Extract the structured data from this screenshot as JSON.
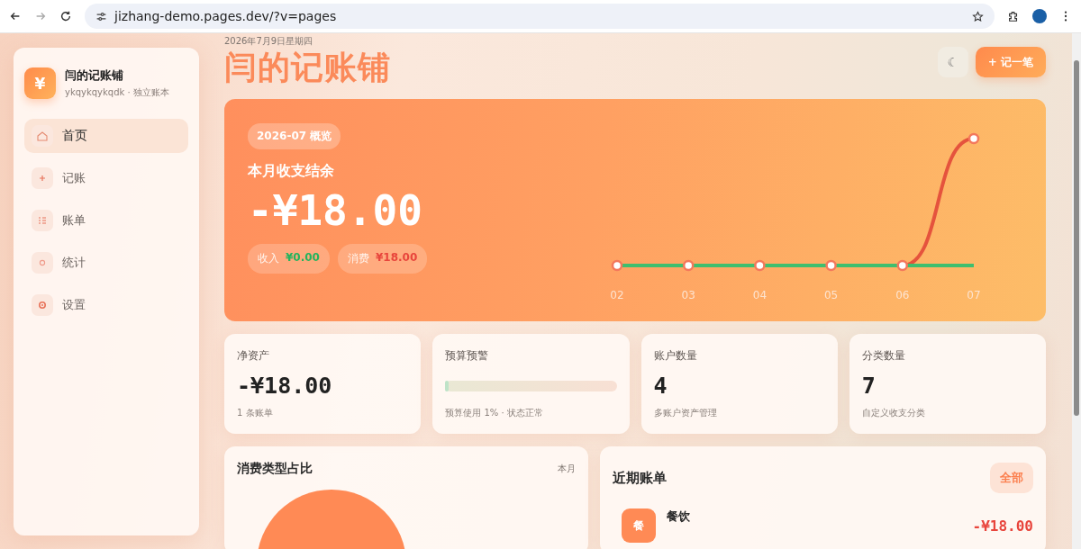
{
  "browser": {
    "url": "jizhang-demo.pages.dev/?v=pages"
  },
  "sidebar": {
    "brand_icon": "¥",
    "title": "闫的记账铺",
    "subtitle": "ykqykqykqdk · 独立账本",
    "items": [
      {
        "label": "首页",
        "kind": "home",
        "selected": true
      },
      {
        "label": "记账",
        "kind": "plus",
        "selected": false
      },
      {
        "label": "账单",
        "kind": "list",
        "selected": false
      },
      {
        "label": "统计",
        "kind": "ring",
        "selected": false
      },
      {
        "label": "设置",
        "kind": "gear",
        "selected": false
      }
    ]
  },
  "header": {
    "date": "2026年7月9日星期四",
    "title": "闫的记账铺",
    "theme_icon": "☾",
    "add_button": "+ 记一笔"
  },
  "hero": {
    "badge": "2026-07 概览",
    "label": "本月收支结余",
    "amount": "-¥18.00",
    "pills": [
      {
        "label": "收入",
        "value": "¥0.00",
        "kind": "income"
      },
      {
        "label": "消费",
        "value": "¥18.00",
        "kind": "expense"
      }
    ],
    "trend_months": [
      "02",
      "03",
      "04",
      "05",
      "06",
      "07"
    ]
  },
  "stats": [
    {
      "title": "净资产",
      "kind": "value",
      "value": "-¥18.00",
      "note": "1 条账单"
    },
    {
      "title": "预算预警",
      "kind": "meter",
      "level": 0.01,
      "note": "预算使用 1% · 状态正常"
    },
    {
      "title": "账户数量",
      "kind": "value",
      "value": "4",
      "note": "多账户资产管理"
    },
    {
      "title": "分类数量",
      "kind": "value",
      "value": "7",
      "note": "自定义收支分类"
    }
  ],
  "category_panel": {
    "title": "消费类型占比",
    "period": "本月"
  },
  "recent_panel": {
    "title": "近期账单",
    "all_button": "全部",
    "rows": [
      {
        "icon": "餐",
        "category": "餐饮",
        "amount": "-¥18.00"
      }
    ]
  }
}
